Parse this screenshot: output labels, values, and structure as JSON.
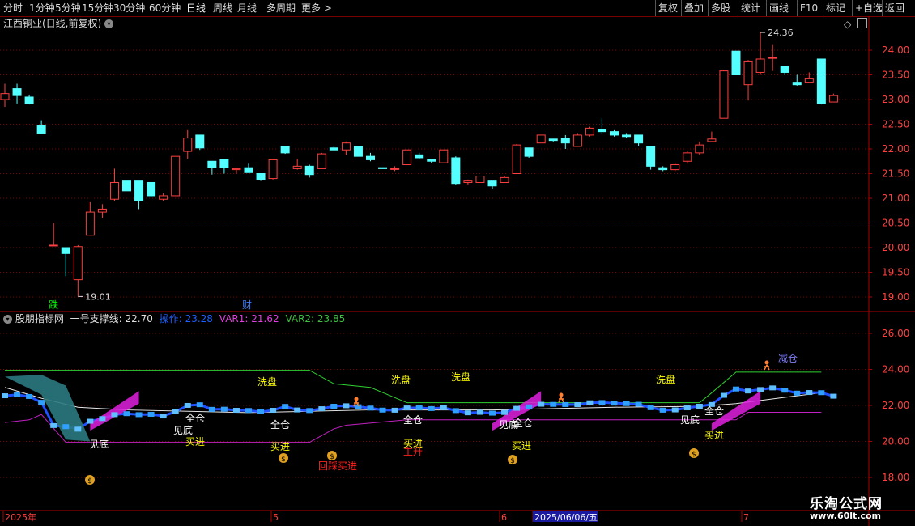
{
  "toolbar": {
    "left": [
      "分时",
      "1分钟",
      "5分钟",
      "15分钟",
      "30分钟",
      "60分钟",
      "日线",
      "周线",
      "月线",
      "多周期",
      "更多 >"
    ],
    "active_index": 6,
    "right": [
      "复权",
      "叠加",
      "多股",
      "统计",
      "画线",
      "F10",
      "标记",
      "+自选",
      "返回"
    ]
  },
  "main_panel": {
    "title": "江西铜业(日线,前复权)",
    "y_axis_labels": [
      "24.00",
      "23.50",
      "23.00",
      "22.50",
      "22.00",
      "21.50",
      "21.00",
      "20.50",
      "20.00",
      "19.50",
      "19.00"
    ],
    "high_marker": "24.36",
    "low_marker": "19.01",
    "event_die": "跌",
    "event_cai": "财"
  },
  "indicator_panel": {
    "name": "股朋指标网",
    "line1_label": "一号支撑线: 22.70",
    "op_label": "操作: 23.28",
    "var1_label": "VAR1: 21.62",
    "var2_label": "VAR2: 23.85",
    "y_axis_labels": [
      "26.00",
      "24.00",
      "22.00",
      "20.00",
      "18.00"
    ],
    "signals": {
      "xipan": "洗盘",
      "quancang": "全仓",
      "jiandi": "见底",
      "mairu": "买进",
      "huicai": "回踩买进",
      "zhusheng": "主升",
      "jiancang": "减仓"
    }
  },
  "date_axis": {
    "labels": [
      "2025年",
      "5",
      "6",
      "2025/06/06/五",
      "7"
    ]
  },
  "watermark": {
    "site": "乐淘公式网",
    "url": "www.60lt.com"
  },
  "colors": {
    "up": "#ff4040",
    "down": "#54ffff",
    "grid": "#800000",
    "axis": "#b00000",
    "green_line": "#00c000",
    "magenta_line": "#c000c0",
    "yellow_text": "#ffff00",
    "blue_text": "#4060ff"
  },
  "chart_data": {
    "type": "candlestick",
    "series": [
      {
        "o": 23.0,
        "h": 23.32,
        "l": 22.85,
        "c": 23.12
      },
      {
        "o": 23.22,
        "h": 23.32,
        "l": 22.92,
        "c": 23.08
      },
      {
        "o": 23.05,
        "h": 23.1,
        "l": 22.9,
        "c": 22.92
      },
      {
        "o": 22.48,
        "h": 22.58,
        "l": 22.3,
        "c": 22.32
      },
      {
        "o": 20.05,
        "h": 20.5,
        "l": 20.05,
        "c": 20.05
      },
      {
        "o": 20.0,
        "h": 20.0,
        "l": 19.42,
        "c": 19.88
      },
      {
        "o": 19.35,
        "h": 20.05,
        "l": 19.01,
        "c": 20.02
      },
      {
        "o": 20.25,
        "h": 20.92,
        "l": 20.25,
        "c": 20.72
      },
      {
        "o": 20.72,
        "h": 20.88,
        "l": 20.6,
        "c": 20.78
      },
      {
        "o": 20.98,
        "h": 21.6,
        "l": 20.95,
        "c": 21.32
      },
      {
        "o": 21.35,
        "h": 21.35,
        "l": 21.15,
        "c": 21.15
      },
      {
        "o": 21.35,
        "h": 21.35,
        "l": 20.78,
        "c": 20.95
      },
      {
        "o": 21.32,
        "h": 21.32,
        "l": 21.02,
        "c": 21.05
      },
      {
        "o": 20.98,
        "h": 21.1,
        "l": 20.95,
        "c": 21.05
      },
      {
        "o": 21.05,
        "h": 21.85,
        "l": 21.05,
        "c": 21.85
      },
      {
        "o": 21.95,
        "h": 22.38,
        "l": 21.8,
        "c": 22.22
      },
      {
        "o": 22.28,
        "h": 22.28,
        "l": 21.98,
        "c": 22.02
      },
      {
        "o": 21.75,
        "h": 21.75,
        "l": 21.48,
        "c": 21.62
      },
      {
        "o": 21.78,
        "h": 21.78,
        "l": 21.5,
        "c": 21.62
      },
      {
        "o": 21.58,
        "h": 21.62,
        "l": 21.5,
        "c": 21.6
      },
      {
        "o": 21.62,
        "h": 21.7,
        "l": 21.52,
        "c": 21.52
      },
      {
        "o": 21.5,
        "h": 21.5,
        "l": 21.35,
        "c": 21.38
      },
      {
        "o": 21.4,
        "h": 21.8,
        "l": 21.38,
        "c": 21.78
      },
      {
        "o": 22.05,
        "h": 22.05,
        "l": 21.9,
        "c": 21.92
      },
      {
        "o": 21.6,
        "h": 21.8,
        "l": 21.58,
        "c": 21.65
      },
      {
        "o": 21.65,
        "h": 21.68,
        "l": 21.42,
        "c": 21.48
      },
      {
        "o": 21.6,
        "h": 21.92,
        "l": 21.6,
        "c": 21.9
      },
      {
        "o": 22.02,
        "h": 22.05,
        "l": 21.98,
        "c": 21.98
      },
      {
        "o": 21.98,
        "h": 22.15,
        "l": 21.88,
        "c": 22.12
      },
      {
        "o": 22.05,
        "h": 22.05,
        "l": 21.85,
        "c": 21.85
      },
      {
        "o": 21.85,
        "h": 21.92,
        "l": 21.75,
        "c": 21.78
      },
      {
        "o": 21.62,
        "h": 21.62,
        "l": 21.6,
        "c": 21.6
      },
      {
        "o": 21.6,
        "h": 21.65,
        "l": 21.55,
        "c": 21.6
      },
      {
        "o": 21.68,
        "h": 21.98,
        "l": 21.68,
        "c": 21.98
      },
      {
        "o": 21.88,
        "h": 21.92,
        "l": 21.8,
        "c": 21.82
      },
      {
        "o": 21.78,
        "h": 21.78,
        "l": 21.72,
        "c": 21.75
      },
      {
        "o": 21.72,
        "h": 21.98,
        "l": 21.72,
        "c": 21.98
      },
      {
        "o": 21.82,
        "h": 21.85,
        "l": 21.28,
        "c": 21.3
      },
      {
        "o": 21.32,
        "h": 21.38,
        "l": 21.28,
        "c": 21.35
      },
      {
        "o": 21.32,
        "h": 21.45,
        "l": 21.32,
        "c": 21.45
      },
      {
        "o": 21.35,
        "h": 21.35,
        "l": 21.18,
        "c": 21.25
      },
      {
        "o": 21.32,
        "h": 21.45,
        "l": 21.32,
        "c": 21.42
      },
      {
        "o": 21.5,
        "h": 22.1,
        "l": 21.5,
        "c": 22.08
      },
      {
        "o": 22.02,
        "h": 22.02,
        "l": 21.82,
        "c": 21.85
      },
      {
        "o": 22.12,
        "h": 22.28,
        "l": 22.12,
        "c": 22.28
      },
      {
        "o": 22.2,
        "h": 22.2,
        "l": 22.15,
        "c": 22.17
      },
      {
        "o": 22.22,
        "h": 22.28,
        "l": 22.0,
        "c": 22.12
      },
      {
        "o": 22.05,
        "h": 22.32,
        "l": 22.05,
        "c": 22.28
      },
      {
        "o": 22.28,
        "h": 22.45,
        "l": 22.25,
        "c": 22.42
      },
      {
        "o": 22.4,
        "h": 22.62,
        "l": 22.3,
        "c": 22.35
      },
      {
        "o": 22.35,
        "h": 22.38,
        "l": 22.25,
        "c": 22.28
      },
      {
        "o": 22.28,
        "h": 22.32,
        "l": 22.22,
        "c": 22.25
      },
      {
        "o": 22.28,
        "h": 22.28,
        "l": 22.05,
        "c": 22.12
      },
      {
        "o": 22.05,
        "h": 22.05,
        "l": 21.58,
        "c": 21.65
      },
      {
        "o": 21.62,
        "h": 21.65,
        "l": 21.55,
        "c": 21.58
      },
      {
        "o": 21.58,
        "h": 21.7,
        "l": 21.55,
        "c": 21.68
      },
      {
        "o": 21.75,
        "h": 21.95,
        "l": 21.7,
        "c": 21.92
      },
      {
        "o": 21.92,
        "h": 22.15,
        "l": 21.88,
        "c": 22.08
      },
      {
        "o": 22.15,
        "h": 22.35,
        "l": 22.15,
        "c": 22.2
      },
      {
        "o": 22.62,
        "h": 23.6,
        "l": 22.62,
        "c": 23.58
      },
      {
        "o": 23.98,
        "h": 23.98,
        "l": 23.5,
        "c": 23.5
      },
      {
        "o": 23.3,
        "h": 23.8,
        "l": 22.98,
        "c": 23.78
      },
      {
        "o": 23.55,
        "h": 24.36,
        "l": 23.5,
        "c": 23.82
      },
      {
        "o": 23.85,
        "h": 24.12,
        "l": 23.58,
        "c": 23.85
      },
      {
        "o": 23.68,
        "h": 23.68,
        "l": 23.5,
        "c": 23.55
      },
      {
        "o": 23.35,
        "h": 23.5,
        "l": 23.28,
        "c": 23.3
      },
      {
        "o": 23.35,
        "h": 23.55,
        "l": 23.35,
        "c": 23.42
      },
      {
        "o": 23.82,
        "h": 23.82,
        "l": 22.9,
        "c": 22.92
      },
      {
        "o": 22.95,
        "h": 23.12,
        "l": 22.95,
        "c": 23.08
      }
    ]
  }
}
